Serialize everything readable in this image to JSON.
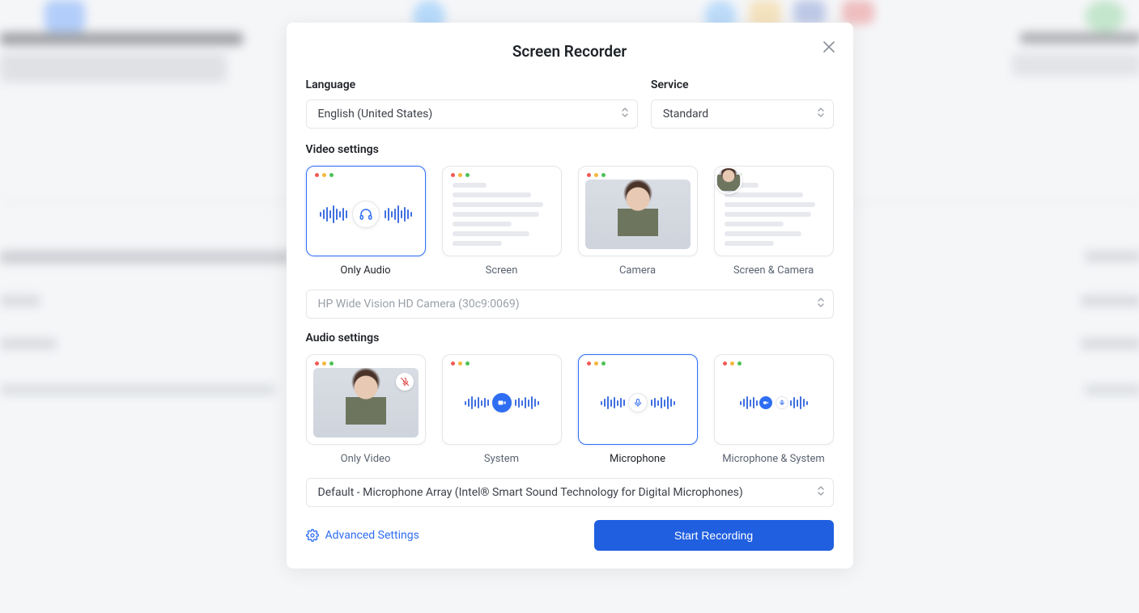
{
  "modal": {
    "title": "Screen Recorder",
    "language": {
      "label": "Language",
      "value": "English (United States)"
    },
    "service": {
      "label": "Service",
      "value": "Standard"
    },
    "video": {
      "section": "Video settings",
      "options": {
        "only_audio": "Only Audio",
        "screen": "Screen",
        "camera": "Camera",
        "screen_camera": "Screen & Camera"
      },
      "camera_select": "HP Wide Vision HD Camera (30c9:0069)"
    },
    "audio": {
      "section": "Audio settings",
      "options": {
        "only_video": "Only Video",
        "system": "System",
        "microphone": "Microphone",
        "mic_system": "Microphone & System"
      },
      "mic_select": "Default - Microphone Array (Intel® Smart Sound Technology for Digital Microphones)"
    },
    "advanced": "Advanced Settings",
    "start": "Start Recording"
  }
}
